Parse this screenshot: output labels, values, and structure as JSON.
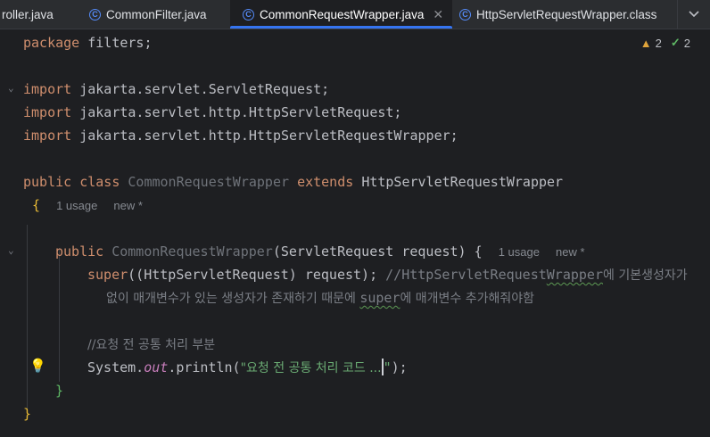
{
  "tabs": [
    {
      "label": "roller.java",
      "icon": null,
      "active": false
    },
    {
      "label": "CommonFilter.java",
      "icon": "class-icon",
      "active": false
    },
    {
      "label": "CommonRequestWrapper.java",
      "icon": "class-icon",
      "active": true
    },
    {
      "label": "HttpServletRequestWrapper.class",
      "icon": "class-icon",
      "active": false
    }
  ],
  "inspection": {
    "warnings": "2",
    "weak_warnings": "2"
  },
  "code": {
    "l1_kw": "package",
    "l1_rest": " filters;",
    "l3_kw": "import",
    "l3_rest": " jakarta.servlet.ServletRequest;",
    "l4_kw": "import",
    "l4_rest": " jakarta.servlet.http.HttpServletRequest;",
    "l5_kw": "import",
    "l5_rest": " jakarta.servlet.http.HttpServletRequestWrapper;",
    "l7_kw1": "public",
    "l7_kw2": "class",
    "l7_cls": "CommonRequestWrapper",
    "l7_kw3": "extends",
    "l7_parent": "HttpServletRequestWrapper",
    "l8_brace": "{",
    "l8_hint1": "1 usage",
    "l8_hint2": "new *",
    "l10_kw": "public",
    "l10_ctor": "CommonRequestWrapper",
    "l10_args": "(ServletRequest request) {",
    "l10_hint1": "1 usage",
    "l10_hint2": "new *",
    "l11_kw": "super",
    "l11_rest": "((HttpServletRequest) request);",
    "l11_com1": " //HttpServletRequest",
    "l11_com_sq": "Wrapper",
    "l11_com2": "에 기본생성자가",
    "l11b_com1": "없이 매개변수가 있는 생성자가 존재하기 때문에 ",
    "l11b_com_sq": "super",
    "l11b_com2": "에 매개변수 추가해줘야함",
    "l13_com": "//요청 전 공통 처리 부분",
    "l14_a": "System.",
    "l14_static": "out",
    "l14_b": ".println(",
    "l14_str1": "\"요청 전 공통 처리 코드 ...",
    "l14_str2": "\"",
    "l14_c": ");",
    "l15_brace": "}",
    "l16_brace": "}"
  }
}
